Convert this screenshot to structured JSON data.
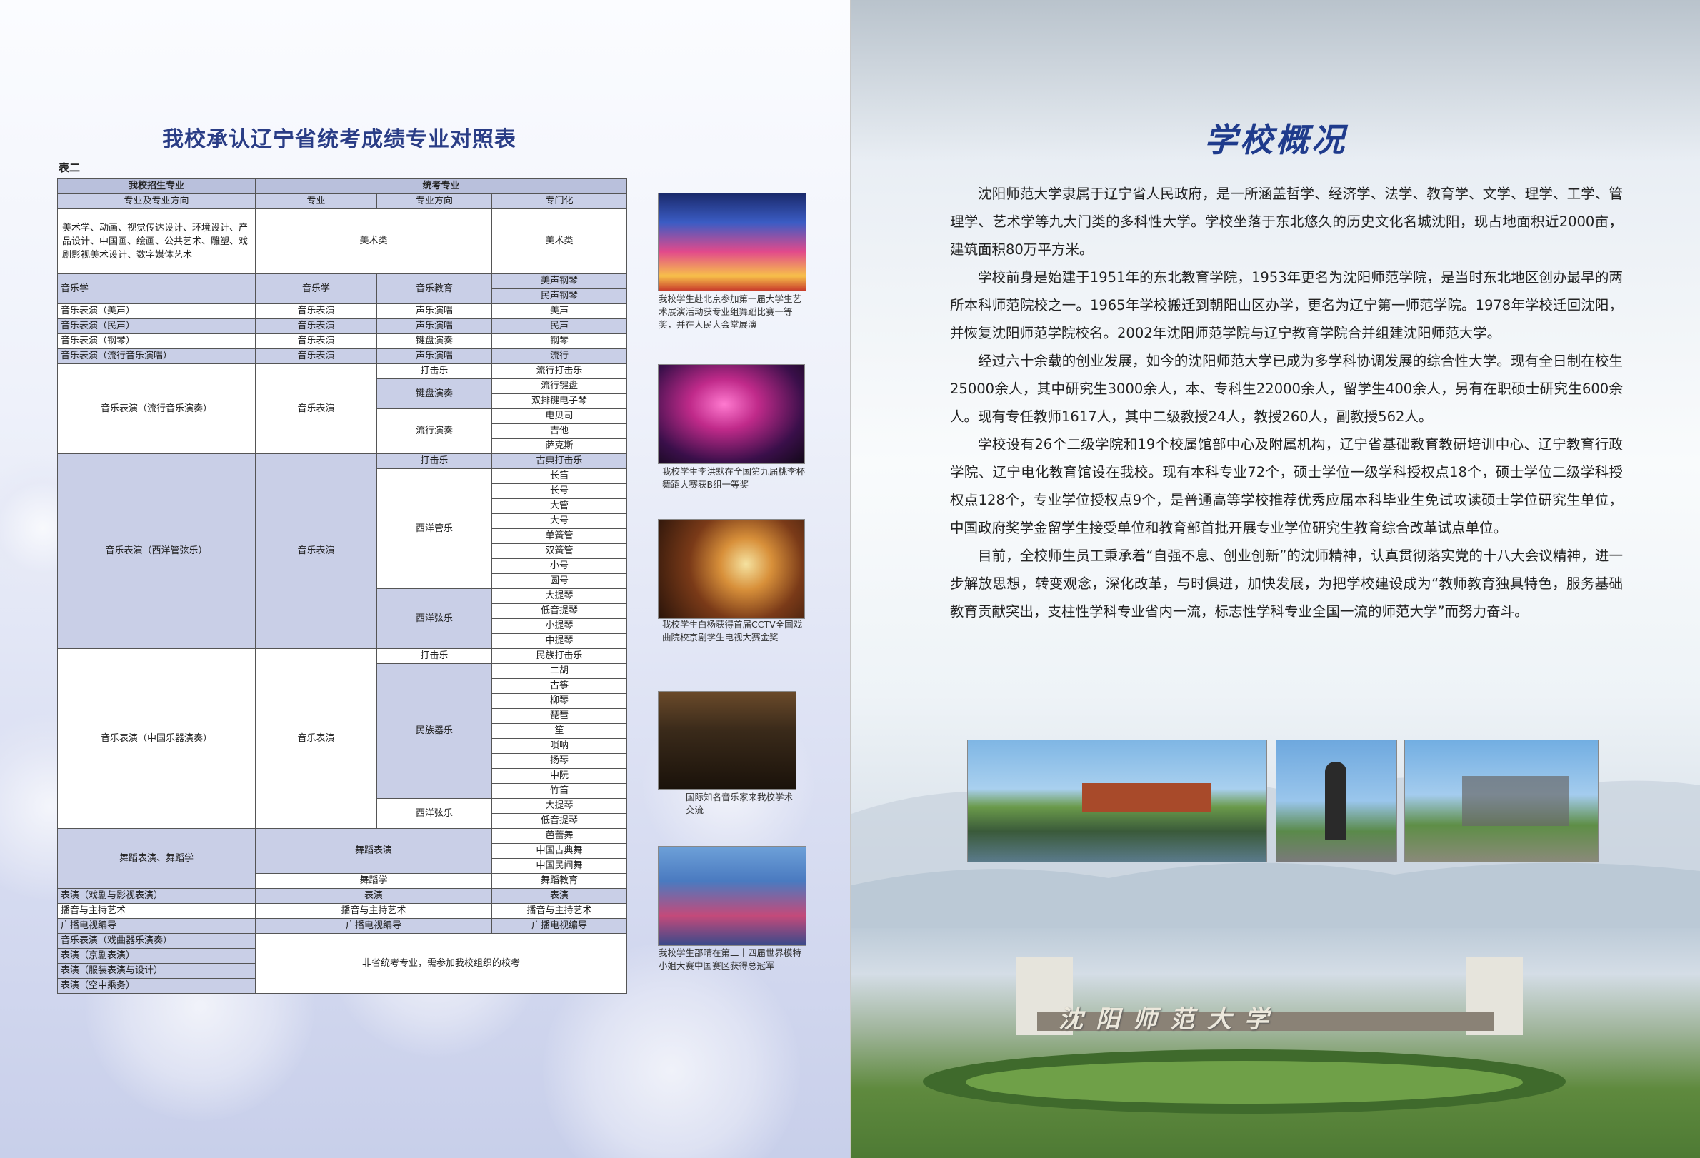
{
  "left": {
    "title": "我校承认辽宁省统考成绩专业对照表",
    "table_label": "表二",
    "table": {
      "header": {
        "school_major": "我校招生专业",
        "exam_major": "统考专业",
        "sub_col1": "专业及专业方向",
        "sub_col2": "专业",
        "sub_col3": "专业方向",
        "sub_col4": "专门化"
      },
      "art": {
        "majors": "美术学、动画、视觉传达设计、环境设计、产品设计、中国画、绘画、公共艺术、雕塑、戏剧影视美术设计、数字媒体艺术",
        "exam": "美术类",
        "spec": "美术类"
      },
      "music": {
        "major": "音乐学",
        "exam": "音乐学",
        "dir": "音乐教育",
        "spec1": "美声钢琴",
        "spec2": "民声钢琴"
      },
      "vocal_rows": [
        {
          "major": "音乐表演（美声）",
          "exam": "音乐表演",
          "dir": "声乐演唱",
          "spec": "美声"
        },
        {
          "major": "音乐表演（民声）",
          "exam": "音乐表演",
          "dir": "声乐演唱",
          "spec": "民声"
        },
        {
          "major": "音乐表演（钢琴）",
          "exam": "音乐表演",
          "dir": "键盘演奏",
          "spec": "钢琴"
        },
        {
          "major": "音乐表演（流行音乐演唱）",
          "exam": "音乐表演",
          "dir": "声乐演唱",
          "spec": "流行"
        }
      ],
      "pop": {
        "major": "音乐表演（流行音乐演奏）",
        "exam": "音乐表演",
        "perc": "打击乐",
        "perc_spec": "流行打击乐",
        "kbd": "键盘演奏",
        "kbd1": "流行键盘",
        "kbd2": "双排键电子琴",
        "band": "流行演奏",
        "band1": "电贝司",
        "band2": "吉他",
        "band3": "萨克斯"
      },
      "western": {
        "major": "音乐表演（西洋管弦乐）",
        "exam": "音乐表演",
        "perc": "打击乐",
        "perc_spec": "古典打击乐",
        "wind": "西洋管乐",
        "wind_items": [
          "长笛",
          "长号",
          "大管",
          "大号",
          "单簧管",
          "双簧管",
          "小号",
          "圆号"
        ],
        "string": "西洋弦乐",
        "string_items": [
          "大提琴",
          "低音提琴",
          "小提琴",
          "中提琴"
        ]
      },
      "chinese": {
        "major": "音乐表演（中国乐器演奏）",
        "exam": "音乐表演",
        "perc": "打击乐",
        "perc_spec": "民族打击乐",
        "folk": "民族器乐",
        "folk_items": [
          "二胡",
          "古筝",
          "柳琴",
          "琵琶",
          "笙",
          "唢呐",
          "扬琴",
          "中阮",
          "竹笛"
        ],
        "string": "西洋弦乐",
        "string_items": [
          "大提琴",
          "低音提琴"
        ]
      },
      "dance": {
        "major": "舞蹈表演、舞蹈学",
        "exam1": "舞蹈表演",
        "items": [
          "芭蕾舞",
          "中国古典舞",
          "中国民间舞"
        ],
        "exam2": "舞蹈学",
        "spec2": "舞蹈教育"
      },
      "misc_rows": [
        {
          "major": "表演（戏剧与影视表演）",
          "exam": "表演",
          "spec": "表演"
        },
        {
          "major": "播音与主持艺术",
          "exam": "播音与主持艺术",
          "spec": "播音与主持艺术"
        },
        {
          "major": "广播电视编导",
          "exam": "广播电视编导",
          "spec": "广播电视编导"
        }
      ],
      "nonexam_majors": [
        "音乐表演（戏曲器乐演奏）",
        "表演（京剧表演）",
        "表演（服装表演与设计）",
        "表演（空中乘务）"
      ],
      "nonexam_note": "非省统考专业，需参加我校组织的校考"
    },
    "photos": [
      {
        "caption": "我校学生赴北京参加第一届大学生艺术展演活动获专业组舞蹈比赛一等奖，并在人民大会堂展演"
      },
      {
        "caption": "我校学生李洪默在全国第九届桃李杯舞蹈大赛获B组一等奖"
      },
      {
        "caption": "我校学生白杨获得首届CCTV全国戏曲院校京剧学生电视大赛金奖"
      },
      {
        "caption": "国际知名音乐家来我校学术交流"
      },
      {
        "caption": "我校学生邵晴在第二十四届世界模特小姐大赛中国赛区获得总冠军"
      }
    ]
  },
  "right": {
    "title": "学校概况",
    "paragraphs": [
      "沈阳师范大学隶属于辽宁省人民政府，是一所涵盖哲学、经济学、法学、教育学、文学、理学、工学、管理学、艺术学等九大门类的多科性大学。学校坐落于东北悠久的历史文化名城沈阳，现占地面积近2000亩，建筑面积80万平方米。",
      "学校前身是始建于1951年的东北教育学院，1953年更名为沈阳师范学院，是当时东北地区创办最早的两所本科师范院校之一。1965年学校搬迁到朝阳山区办学，更名为辽宁第一师范学院。1978年学校迁回沈阳，并恢复沈阳师范学院校名。2002年沈阳师范学院与辽宁教育学院合并组建沈阳师范大学。",
      "经过六十余载的创业发展，如今的沈阳师范大学已成为多学科协调发展的综合性大学。现有全日制在校生25000余人，其中研究生3000余人，本、专科生22000余人，留学生400余人，另有在职硕士研究生600余人。现有专任教师1617人，其中二级教授24人，教授260人，副教授562人。",
      "学校设有26个二级学院和19个校属馆部中心及附属机构，辽宁省基础教育教研培训中心、辽宁教育行政学院、辽宁电化教育馆设在我校。现有本科专业72个，硕士学位一级学科授权点18个，硕士学位二级学科授权点128个，专业学位授权点9个，是普通高等学校推荐优秀应届本科毕业生免试攻读硕士学位研究生单位，中国政府奖学金留学生接受单位和教育部首批开展专业学位研究生教育综合改革试点单位。",
      "目前，全校师生员工秉承着“自强不息、创业创新”的沈师精神，认真贯彻落实党的十八大会议精神，进一步解放思想，转变观念，深化改革，与时俱进，加快发展，为把学校建设成为“教师教育独具特色，服务基础教育贡献突出，支柱性学科专业省内一流，标志性学科专业全国一流的师范大学”而努力奋斗。"
    ],
    "gate_sign": "沈阳师范大学"
  }
}
